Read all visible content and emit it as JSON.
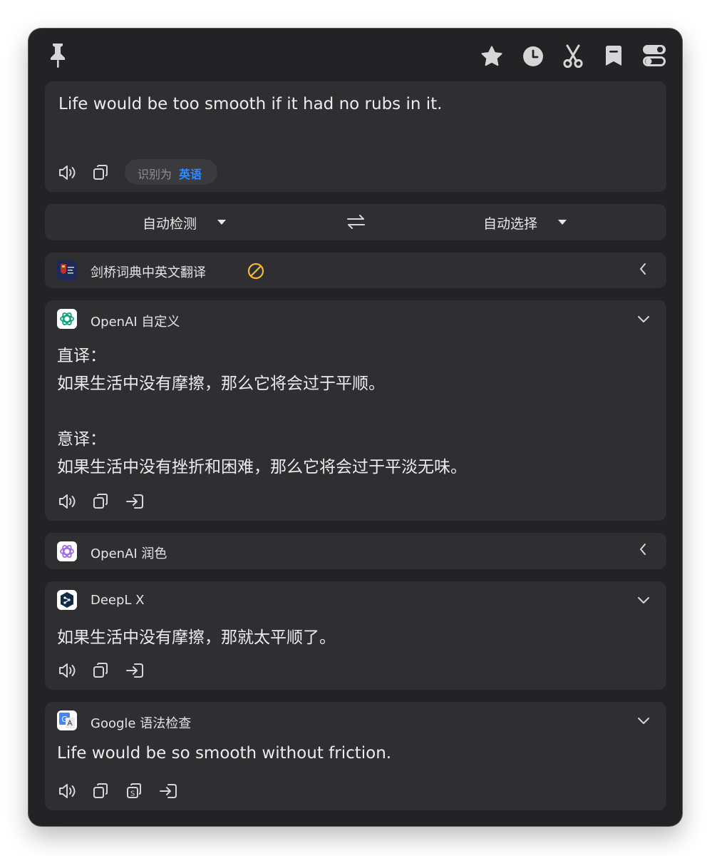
{
  "toolbar": {
    "pin_icon": "pin-icon",
    "right_icons": [
      "star-icon",
      "history-clock-icon",
      "scissors-icon",
      "bookmark-icon",
      "toggle-settings-icon"
    ]
  },
  "source": {
    "text": "Life would be too smooth if it had no rubs in it.",
    "detected_prefix": "识别为",
    "detected_language": "英语"
  },
  "language_bar": {
    "from": "自动检测",
    "to": "自动选择",
    "swap_icon": "swap-arrows-icon"
  },
  "services": {
    "cambridge": {
      "title": "剑桥词典中英文翻译",
      "status_icon": "unavailable-icon",
      "state": "collapsed"
    },
    "openai_custom": {
      "title": "OpenAI 自定义",
      "lines": [
        "直译：",
        "如果生活中没有摩擦，那么它将会过于平顺。",
        "",
        "意译：",
        "如果生活中没有挫折和困难，那么它将会过于平淡无味。"
      ]
    },
    "openai_polish": {
      "title": "OpenAI 润色",
      "state": "collapsed"
    },
    "deepl": {
      "title": "DeepL X",
      "result": "如果生活中没有摩擦，那就太平顺了。"
    },
    "google": {
      "title": "Google 语法检查",
      "result": "Life would be so smooth without friction."
    }
  },
  "colors": {
    "window_bg": "#232325",
    "card_bg": "#2f2f32",
    "accent_blue": "#2f8cff",
    "warning_yellow": "#f5b833"
  }
}
